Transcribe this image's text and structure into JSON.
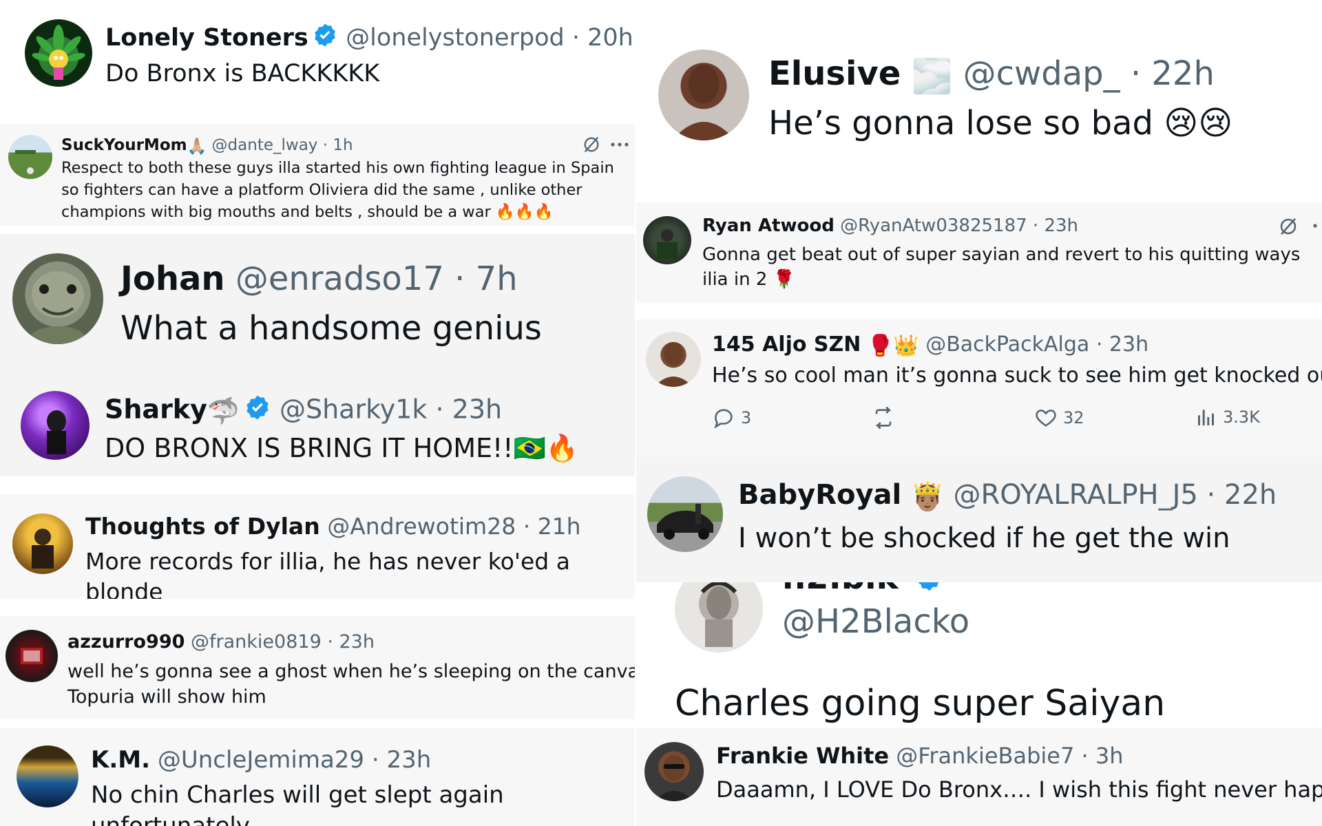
{
  "left_column": {
    "tweets": [
      {
        "name": "Lonely Stoners",
        "verified": true,
        "handle": "@lonelystonerpod",
        "time": "20h",
        "text": "Do Bronx is BACKKKKK",
        "avatar_icon": "cannabis-leaf-cartoon-avatar"
      },
      {
        "name": "SuckYourMom",
        "name_emoji": "🙏🏼",
        "handle": "@dante_lway",
        "time": "1h",
        "text": "Respect to both these guys illa started his own fighting league in Spain so fighters can have a platform Oliviera did the same , unlike other champions with big mouths and belts , should be a war",
        "trailing_emoji": "🔥🔥🔥",
        "avatar_icon": "field-landscape-avatar"
      },
      {
        "name": "Johan",
        "handle": "@enradso17",
        "time": "7h",
        "text": "What a handsome genius",
        "avatar_icon": "turtle-avatar"
      },
      {
        "name": "Sharky",
        "name_emoji": "🦈",
        "verified": true,
        "handle": "@Sharky1k",
        "time": "23h",
        "text": "DO BRONX IS BRING IT HOME!!",
        "trailing_emoji": "🇧🇷🔥",
        "avatar_icon": "purple-concert-avatar"
      },
      {
        "name": "Thoughts of Dylan",
        "handle": "@Andrewotim28",
        "time": "21h",
        "text": "More records for illia, he has never ko'ed a blonde",
        "avatar_icon": "fighter-gold-avatar"
      },
      {
        "name": "azzurro990",
        "handle": "@frankie0819",
        "time": "23h",
        "text_line1": "well he’s gonna see a ghost when he’s sleeping on the canvas",
        "text_emoji": "😂",
        "text_line2": "Topuria will show him",
        "avatar_icon": "dark-red-logo-avatar"
      },
      {
        "name": "K.M.",
        "handle": "@UncleJemima29",
        "time": "23h",
        "text": "No chin Charles will get slept again unfortunately",
        "avatar_icon": "blue-planet-avatar"
      }
    ]
  },
  "right_column": {
    "tweets": [
      {
        "name": "Elusive",
        "name_emoji": "🌫️",
        "handle": "@cwdap_",
        "time": "22h",
        "text": "He’s gonna lose so bad",
        "trailing_emoji": "😢😢",
        "avatar_icon": "fighter-portrait-avatar"
      },
      {
        "name": "Ryan Atwood",
        "handle": "@RyanAtw03825187",
        "time": "23h",
        "text": "Gonna get beat out of super sayian and revert to his quitting ways ilia in 2",
        "trailing_emoji": "🌹",
        "avatar_icon": "group-photo-avatar"
      },
      {
        "name": "145 Aljo SZN",
        "name_emoji": "🥊👑",
        "handle": "@BackPackAlga",
        "time": "23h",
        "text": "He’s so cool man it’s gonna suck to see him get knocked out",
        "trailing_emoji": "😞",
        "avatar_icon": "fighter-headshot-avatar",
        "stats": {
          "replies": "3",
          "likes": "32",
          "views": "3.3K"
        }
      },
      {
        "name": "BabyRoyal",
        "name_emoji": "🤴🏽",
        "handle": "@ROYALRALPH_J5",
        "time": "22h",
        "text": "I won’t be shocked if he get the win",
        "avatar_icon": "car-photo-avatar"
      },
      {
        "name_partial": "h2.blk",
        "handle": "@H2Blacko",
        "text": "Charles going super Saiyan",
        "avatar_icon": "sketch-portrait-avatar"
      },
      {
        "name": "Frankie White",
        "handle": "@FrankieBabie7",
        "time": "3h",
        "text": "Daaamn, I LOVE Do Bronx…. I wish this fight never happen",
        "avatar_icon": "man-sunglasses-avatar"
      }
    ]
  },
  "colors": {
    "text_primary": "#0f1419",
    "text_secondary": "#536471",
    "verified_blue": "#1d9bf0",
    "card_gray": "#f7f7f7",
    "divider": "#eff3f4"
  }
}
